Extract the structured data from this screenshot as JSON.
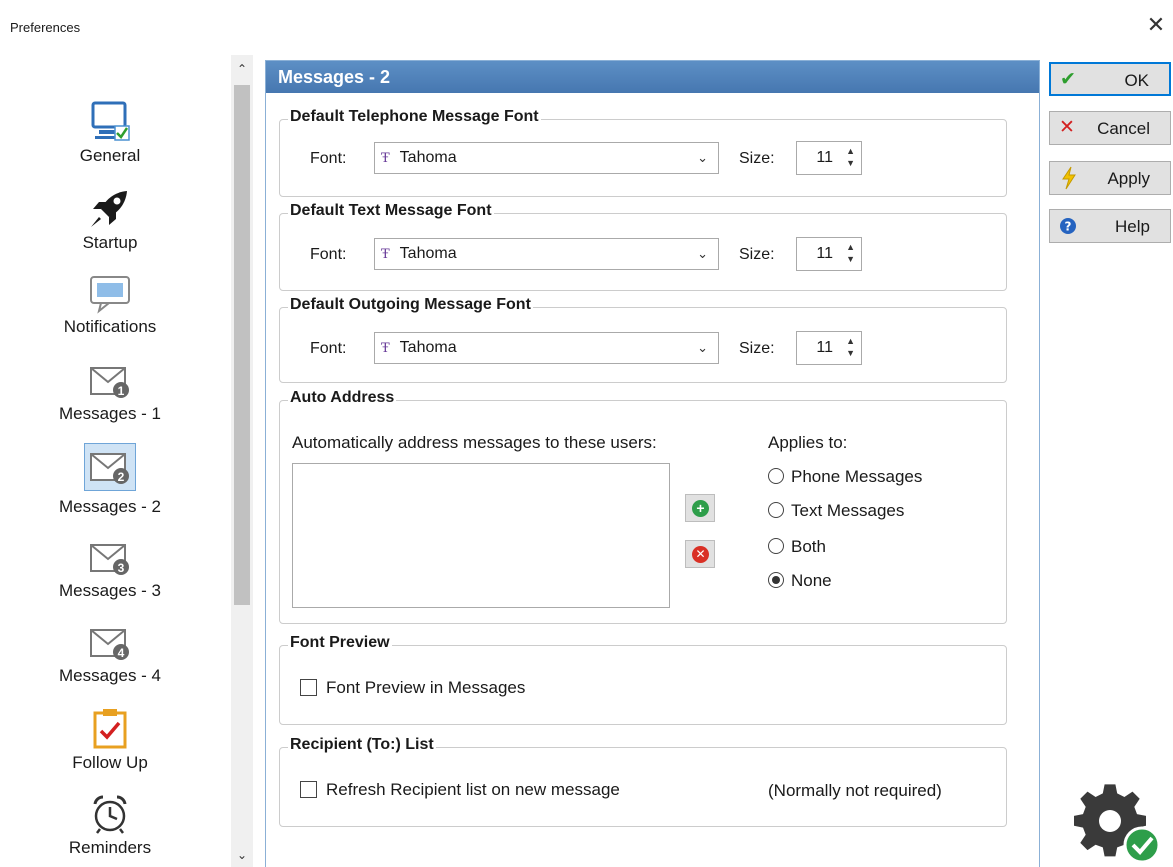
{
  "window": {
    "title": "Preferences",
    "close_glyph": "✕"
  },
  "sidebar": {
    "items": [
      {
        "label": "General",
        "icon": "monitor-check-icon"
      },
      {
        "label": "Startup",
        "icon": "rocket-icon"
      },
      {
        "label": "Notifications",
        "icon": "speech-bubble-icon"
      },
      {
        "label": "Messages - 1",
        "icon": "envelope-1-icon",
        "badge": "1"
      },
      {
        "label": "Messages - 2",
        "icon": "envelope-2-icon",
        "badge": "2",
        "selected": true
      },
      {
        "label": "Messages - 3",
        "icon": "envelope-3-icon",
        "badge": "3"
      },
      {
        "label": "Messages - 4",
        "icon": "envelope-4-icon",
        "badge": "4"
      },
      {
        "label": "Follow Up",
        "icon": "clipboard-check-icon"
      },
      {
        "label": "Reminders",
        "icon": "alarm-clock-icon"
      }
    ]
  },
  "panel": {
    "title": "Messages - 2",
    "telephone_font": {
      "title": "Default Telephone Message Font",
      "font_label": "Font:",
      "font_value": "Tahoma",
      "size_label": "Size:",
      "size_value": "11"
    },
    "text_font": {
      "title": "Default Text Message Font",
      "font_label": "Font:",
      "font_value": "Tahoma",
      "size_label": "Size:",
      "size_value": "11"
    },
    "outgoing_font": {
      "title": "Default Outgoing Message Font",
      "font_label": "Font:",
      "font_value": "Tahoma",
      "size_label": "Size:",
      "size_value": "11"
    },
    "auto_address": {
      "title": "Auto Address",
      "list_label": "Automatically address messages to these users:",
      "applies_label": "Applies to:",
      "options": [
        {
          "label": "Phone Messages",
          "selected": false
        },
        {
          "label": "Text Messages",
          "selected": false
        },
        {
          "label": "Both",
          "selected": false
        },
        {
          "label": "None",
          "selected": true
        }
      ]
    },
    "font_preview": {
      "title": "Font Preview",
      "checkbox_label": "Font Preview in Messages",
      "checked": false
    },
    "recipient": {
      "title": "Recipient (To:) List",
      "checkbox_label": "Refresh Recipient list on new message",
      "note": "(Normally not required)",
      "checked": false
    }
  },
  "buttons": {
    "ok": "OK",
    "cancel": "Cancel",
    "apply": "Apply",
    "help": "Help"
  },
  "colors": {
    "header": "#4a7ab4",
    "accent": "#0078d7",
    "ok_check": "#2e9e2e",
    "cancel_x": "#d32020",
    "add_green": "#2e9e4a",
    "remove_red": "#d93025"
  }
}
